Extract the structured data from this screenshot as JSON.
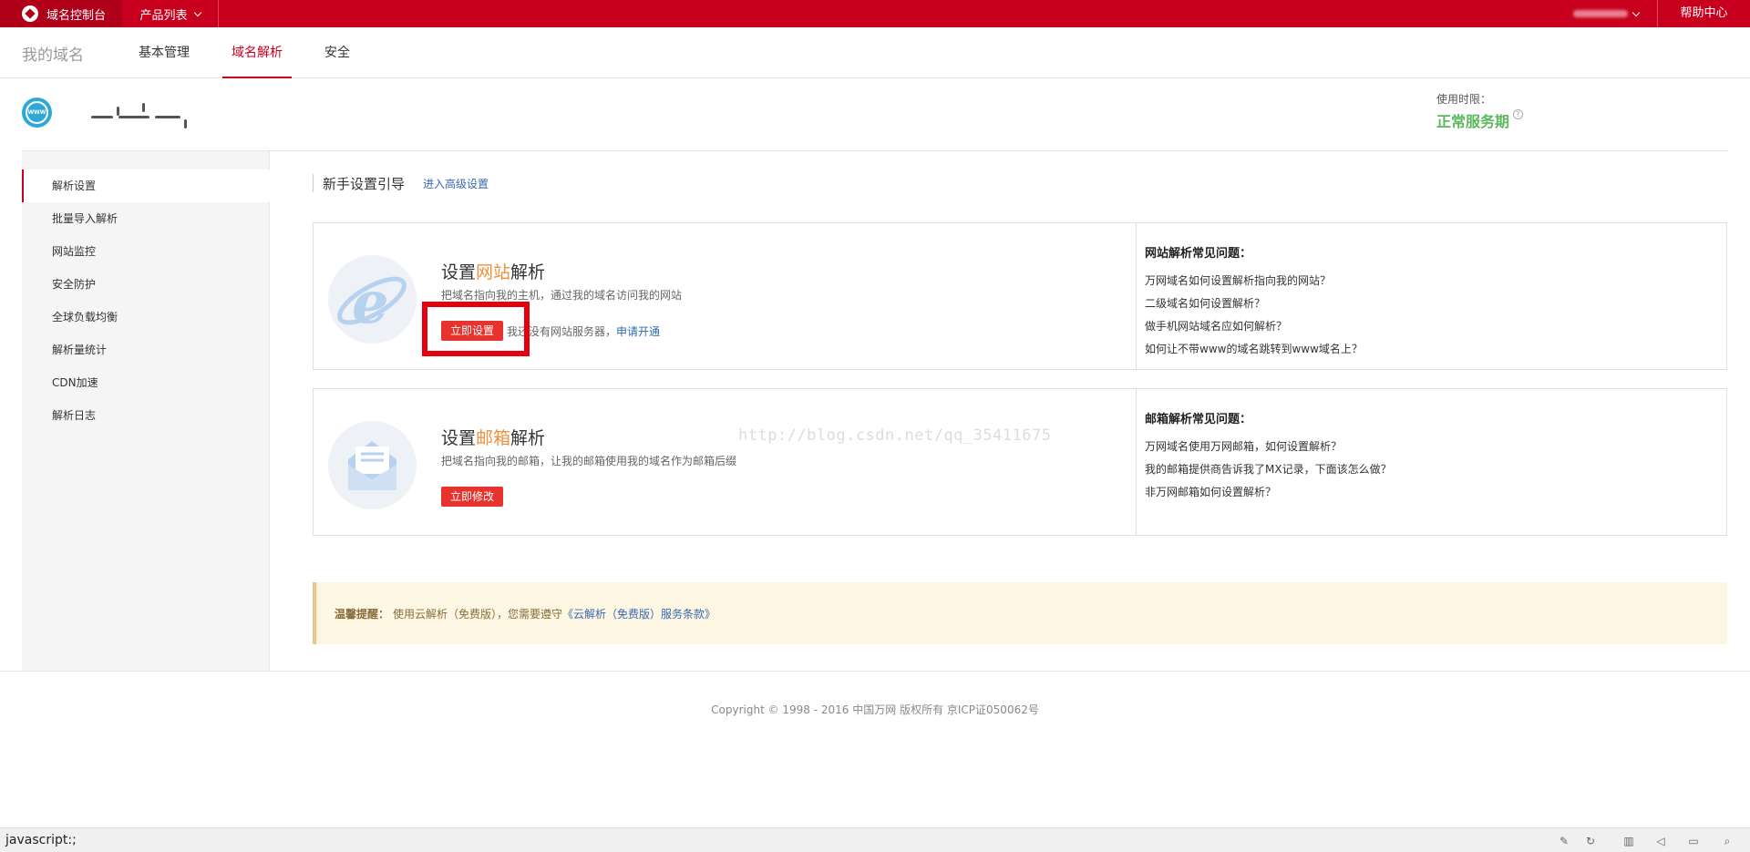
{
  "topbar": {
    "brand": "域名控制台",
    "products": "产品列表",
    "help": "帮助中心"
  },
  "subnav": {
    "title": "我的域名",
    "tabs": [
      "基本管理",
      "域名解析",
      "安全"
    ]
  },
  "domain": {
    "usage_label": "使用时限：",
    "usage_status": "正常服务期",
    "help_mark": "?"
  },
  "sidebar": {
    "items": [
      "解析设置",
      "批量导入解析",
      "网站监控",
      "安全防护",
      "全球负载均衡",
      "解析量统计",
      "CDN加速",
      "解析日志"
    ]
  },
  "guide": {
    "title": "新手设置引导",
    "advanced_link": "进入高级设置"
  },
  "website_card": {
    "title_pre": "设置",
    "title_hl": "网站",
    "title_post": "解析",
    "desc": "把域名指向我的主机，通过我的域名访问我的网站",
    "button": "立即设置",
    "extra_text": "我还没有网站服务器，",
    "extra_link": "申请开通",
    "faq_title": "网站解析常见问题：",
    "faq": [
      "万网域名如何设置解析指向我的网站？",
      "二级域名如何设置解析？",
      "做手机网站域名应如何解析？",
      "如何让不带www的域名跳转到www域名上？"
    ]
  },
  "email_card": {
    "title_pre": "设置",
    "title_hl": "邮箱",
    "title_post": "解析",
    "desc": "把域名指向我的邮箱，让我的邮箱使用我的域名作为邮箱后缀",
    "button": "立即修改",
    "faq_title": "邮箱解析常见问题：",
    "faq": [
      "万网域名使用万网邮箱，如何设置解析？",
      "我的邮箱提供商告诉我了MX记录，下面该怎么做？",
      "非万网邮箱如何设置解析？"
    ]
  },
  "watermark": "http://blog.csdn.net/qq_35411675",
  "notice": {
    "label": "温馨提醒：",
    "text": "使用云解析（免费版），您需要遵守",
    "link": "《云解析（免费版）服务条款》"
  },
  "footer": {
    "copyright": "Copyright © 1998 - 2016 中国万网 版权所有 京ICP证050062号"
  },
  "statusbar": {
    "text": "javascript:;"
  },
  "colors": {
    "brand_red": "#c8001e",
    "button_red": "#e8322e",
    "status_green": "#5cb85c",
    "highlight_orange": "#f0903c"
  }
}
